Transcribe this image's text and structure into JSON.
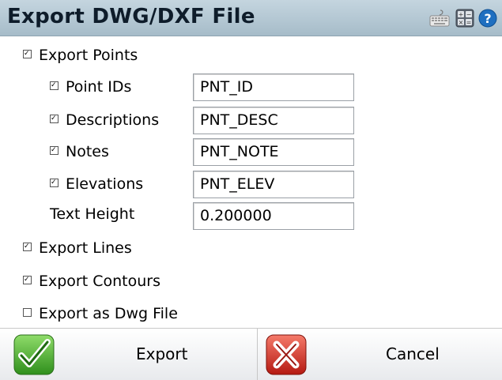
{
  "window": {
    "title": "Export DWG/DXF File"
  },
  "titlebar_icons": [
    "keyboard-icon",
    "calculator-icon",
    "help-icon"
  ],
  "options": {
    "export_points": {
      "label": "Export Points",
      "checked": true
    },
    "point_ids": {
      "label": "Point IDs",
      "checked": true,
      "value": "PNT_ID"
    },
    "descriptions": {
      "label": "Descriptions",
      "checked": true,
      "value": "PNT_DESC"
    },
    "notes": {
      "label": "Notes",
      "checked": true,
      "value": "PNT_NOTE"
    },
    "elevations": {
      "label": "Elevations",
      "checked": true,
      "value": "PNT_ELEV"
    },
    "text_height": {
      "label": "Text Height",
      "value": "0.200000"
    },
    "export_lines": {
      "label": "Export Lines",
      "checked": true
    },
    "export_contours": {
      "label": "Export Contours",
      "checked": true
    },
    "export_dwg": {
      "label": "Export as Dwg File",
      "checked": false
    }
  },
  "buttons": {
    "export": {
      "label": "Export"
    },
    "cancel": {
      "label": "Cancel"
    }
  },
  "colors": {
    "titlebar": "#b5c8d4",
    "accent_ok": "#3fae2a",
    "accent_cancel": "#d5261f"
  }
}
